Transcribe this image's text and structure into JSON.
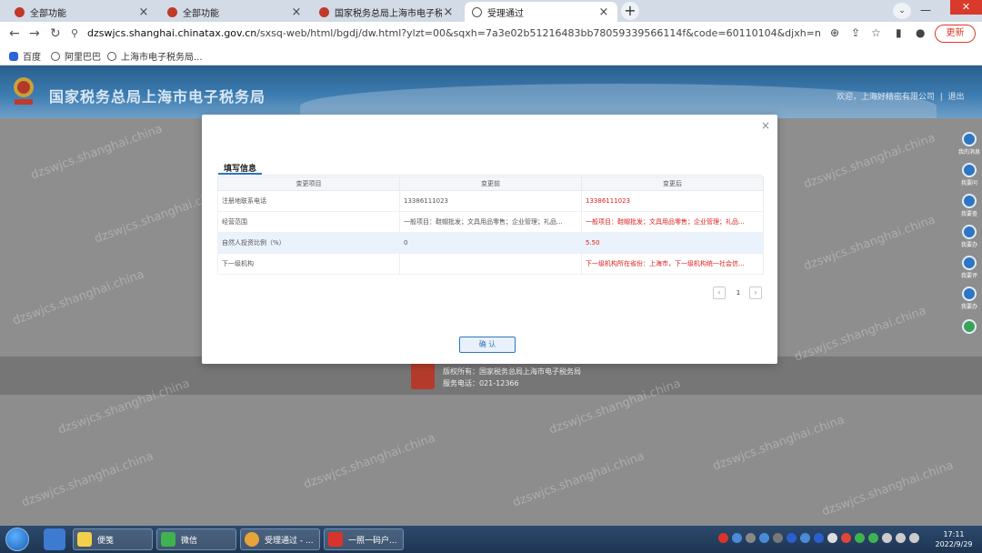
{
  "browser": {
    "tabs": [
      {
        "title": "全部功能",
        "icon": "tax-emblem-icon",
        "active": false
      },
      {
        "title": "全部功能",
        "icon": "tax-emblem-icon",
        "active": false
      },
      {
        "title": "国家税务总局上海市电子税务局",
        "icon": "tax-emblem-icon",
        "active": false
      },
      {
        "title": "受理通过",
        "icon": "globe-icon",
        "active": true
      }
    ],
    "url_host": "dzswjcs.shanghai.chinatax.gov.cn",
    "url_path": "/sxsq-web/html/bgdj/dw.html?ylzt=00&sqxh=7a3e02b51216483bb78059339566114f&code=60110104&djxh=null&fromtc=null&agen...",
    "update_label": "更新",
    "bookmarks": [
      {
        "label": "百度",
        "icon": "paw-icon"
      },
      {
        "label": "阿里巴巴",
        "icon": "globe-icon"
      },
      {
        "label": "上海市电子税务局...",
        "icon": "globe-icon"
      }
    ]
  },
  "site": {
    "title": "国家税务总局上海市电子税务局",
    "welcome": "欢迎，上海好精密有限公司",
    "logout": "退出",
    "watermark": "dzswjcs.shanghai.china",
    "footer_copyright": "版权所有：国家税务总局上海市电子税务局",
    "footer_phone": "服务电话：021-12366",
    "sidebar": [
      {
        "label": "我的消息",
        "icon": "message-icon"
      },
      {
        "label": "我要问",
        "icon": "question-icon"
      },
      {
        "label": "我要查",
        "icon": "search-icon"
      },
      {
        "label": "我要办",
        "icon": "briefcase-icon"
      },
      {
        "label": "我要评",
        "icon": "star-icon"
      },
      {
        "label": "我要办",
        "icon": "pencil-icon"
      },
      {
        "label": "",
        "icon": "robot-icon"
      }
    ]
  },
  "modal": {
    "tab_label": "填写信息",
    "columns": [
      "变更项目",
      "变更前",
      "变更后"
    ],
    "rows": [
      {
        "item": "注册地联系电话",
        "before": "13386111023",
        "after": "13386111023"
      },
      {
        "item": "经营范围",
        "before": "一般项目：鞋帽批发；文具用品零售；企业管理；礼品...",
        "after": "一般项目：鞋帽批发；文具用品零售；企业管理；礼品..."
      },
      {
        "item": "自然人投资比例（%）",
        "before": "0",
        "after": "5.50"
      },
      {
        "item": "下一级机构",
        "before": "",
        "after": "下一级机构所在省份：上海市，下一级机构统一社会信..."
      }
    ],
    "page": "1",
    "confirm_label": "确 认"
  },
  "taskbar": {
    "items": [
      {
        "label": "便笺",
        "color": "#f2d04a"
      },
      {
        "label": "微信",
        "color": "#3fb34f"
      },
      {
        "label": "受理通过 - ...",
        "color": "#e8a33a"
      },
      {
        "label": "一照一码户...",
        "color": "#d9342b"
      }
    ],
    "time": "17:11",
    "date": "2022/9/29"
  },
  "colors": {
    "accent": "#2f76c2",
    "changed": "#e02020",
    "header": "#2a5f8e"
  }
}
